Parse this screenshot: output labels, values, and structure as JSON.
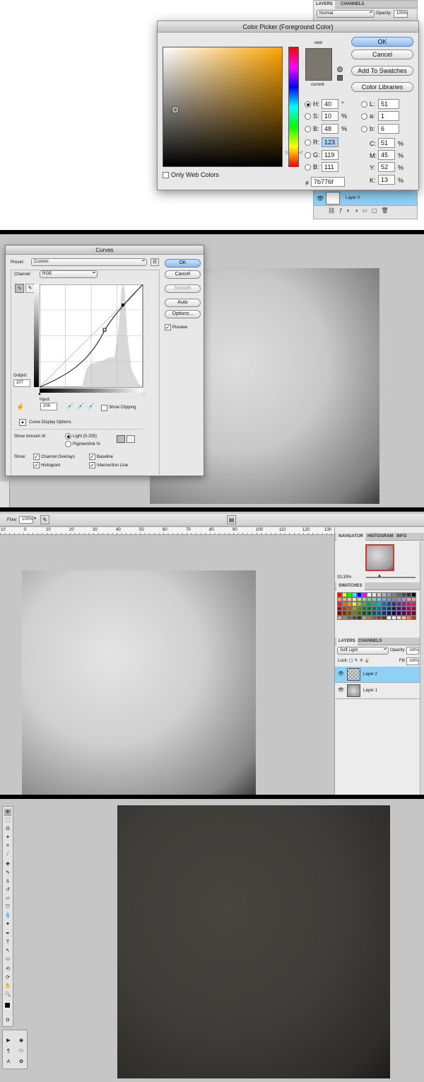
{
  "colorPicker": {
    "title": "Color Picker (Foreground Color)",
    "new_label": "new",
    "current_label": "current",
    "ok": "OK",
    "cancel": "Cancel",
    "add_swatches": "Add To Swatches",
    "color_libraries": "Color Libraries",
    "only_web": "Only Web Colors",
    "hsb": {
      "h_label": "H:",
      "h": "40",
      "h_unit": "°",
      "s_label": "S:",
      "s": "10",
      "s_unit": "%",
      "b_label": "B:",
      "b": "48",
      "b_unit": "%"
    },
    "rgb": {
      "r_label": "R:",
      "r": "123",
      "g_label": "G:",
      "g": "119",
      "b_label": "B:",
      "b": "111"
    },
    "lab": {
      "l_label": "L:",
      "l": "51",
      "a_label": "a:",
      "a": "1",
      "b_label": "b:",
      "b": "6"
    },
    "cmyk": {
      "c_label": "C:",
      "c": "51",
      "m_label": "M:",
      "m": "45",
      "y_label": "Y:",
      "y": "52",
      "k_label": "K:",
      "k": "13",
      "unit": "%"
    },
    "hex_label": "#",
    "hex": "7b776f",
    "swatch_color": "#7b776f"
  },
  "layers1": {
    "tab_layers": "LAYERS",
    "tab_channels": "CHANNELS",
    "blend": "Normal",
    "opacity_label": "Opacity:",
    "opacity": "100%",
    "layer0": "Layer 0"
  },
  "curves": {
    "title": "Curves",
    "preset_label": "Preset:",
    "preset": "Custom",
    "channel_label": "Channel:",
    "channel": "RGB",
    "ok": "OK",
    "cancel": "Cancel",
    "smooth": "Smooth",
    "auto": "Auto",
    "options": "Options...",
    "preview": "Preview",
    "output_label": "Output:",
    "output": "207",
    "input_label": "Input:",
    "input": "209",
    "show_clipping": "Show Clipping",
    "display_options": "Curve Display Options",
    "show_amount_label": "Show Amount of:",
    "light": "Light  (0-255)",
    "pigment": "Pigment/Ink %",
    "show_label": "Show:",
    "channel_overlays": "Channel Overlays",
    "baseline": "Baseline",
    "histogram": "Histogram",
    "intersection": "Intersection Line"
  },
  "panels3": {
    "flow_label": "Flow:",
    "flow": "100%",
    "ruler": [
      "10",
      "0",
      "10",
      "20",
      "30",
      "40",
      "50",
      "60",
      "70",
      "80",
      "90",
      "100",
      "110",
      "120",
      "130"
    ],
    "nav_tabs": [
      "NAVIGATOR",
      "HISTOGRAM",
      "INFO"
    ],
    "zoom": "33.33%",
    "swatches_tab": "SWATCHES",
    "layers_tab": "LAYERS",
    "channels_tab": "CHANNELS",
    "blend": "Soft Light",
    "opacity_label": "Opacity:",
    "opacity": "100%",
    "lock_label": "Lock:",
    "fill_label": "Fill:",
    "fill": "100%",
    "layer2": "Layer 2",
    "layer1": "Layer 1"
  },
  "swatch_colors": [
    "#ff0000",
    "#ffff00",
    "#00ff00",
    "#00ffff",
    "#0000ff",
    "#ff00ff",
    "#ffffff",
    "#e5e5e5",
    "#cccccc",
    "#b3b3b3",
    "#999999",
    "#808080",
    "#666666",
    "#4d4d4d",
    "#333333",
    "#000000",
    "#f7977a",
    "#f9ad81",
    "#fdc68a",
    "#fff79a",
    "#c4df9b",
    "#a2d39c",
    "#82ca9d",
    "#7bcdc8",
    "#6ecff6",
    "#7ea7d8",
    "#8493ca",
    "#8882be",
    "#a187be",
    "#bc8dbf",
    "#f49ac2",
    "#f6989d",
    "#ed1c24",
    "#f26522",
    "#f7941d",
    "#fff200",
    "#8dc63f",
    "#39b54a",
    "#00a651",
    "#00a99d",
    "#00aeef",
    "#0072bc",
    "#0054a6",
    "#2e3192",
    "#662d91",
    "#92278f",
    "#ec008c",
    "#ed145b",
    "#9e0b0f",
    "#a0410d",
    "#a3620a",
    "#aba000",
    "#598527",
    "#1a7b30",
    "#007236",
    "#00746b",
    "#0076a3",
    "#004b80",
    "#003471",
    "#1b1464",
    "#440e62",
    "#630460",
    "#9e005d",
    "#9e0039",
    "#790000",
    "#7b2e00",
    "#7d4900",
    "#827b00",
    "#406618",
    "#005e20",
    "#005826",
    "#005952",
    "#005b7f",
    "#003663",
    "#002157",
    "#0d004c",
    "#32004b",
    "#4b0049",
    "#7b0046",
    "#7a0026",
    "#c7b299",
    "#998675",
    "#736357",
    "#534741",
    "#37302d",
    "#c69c6d",
    "#a67c52",
    "#8c6239",
    "#754c24",
    "#603913",
    "#ffffff",
    "#fff4e0",
    "#ffe0c0",
    "#ffc080",
    "#ff8040",
    "#c04000"
  ],
  "texture_colors": {
    "gray": "#bdbdbd",
    "dark": "#3a3835"
  }
}
